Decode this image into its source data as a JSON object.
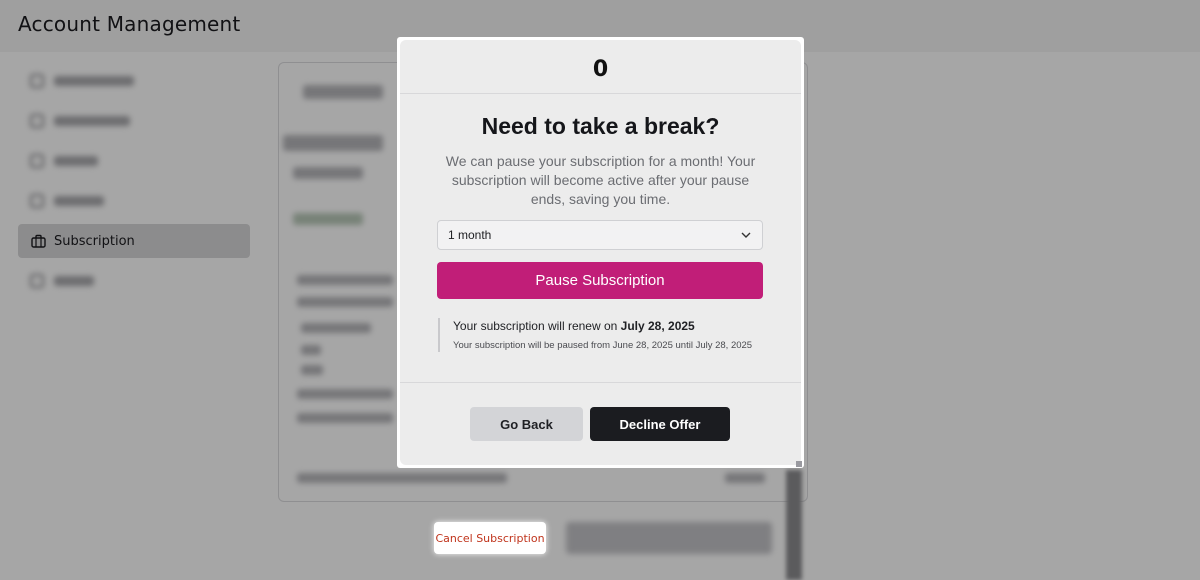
{
  "page": {
    "title": "Account Management"
  },
  "sidebar": {
    "items": [
      {
        "label": "",
        "icon": "placeholder-icon",
        "active": false
      },
      {
        "label": "",
        "icon": "placeholder-icon",
        "active": false
      },
      {
        "label": "",
        "icon": "placeholder-icon",
        "active": false
      },
      {
        "label": "",
        "icon": "placeholder-icon",
        "active": false
      },
      {
        "label": "Subscription",
        "icon": "briefcase-icon",
        "active": true
      },
      {
        "label": "",
        "icon": "placeholder-icon",
        "active": false
      }
    ]
  },
  "footer": {
    "cancel_label": "Cancel Subscription"
  },
  "modal": {
    "logo": "0",
    "heading": "Need to take a break?",
    "description": "We can pause your subscription for a month! Your subscription will become active after your pause ends, saving you time.",
    "duration_select": {
      "value": "1 month"
    },
    "pause_button": "Pause Subscription",
    "renew_prefix": "Your subscription will renew on ",
    "renew_date": "July 28, 2025",
    "pause_info": "Your subscription will be paused from June 28, 2025 until July 28, 2025",
    "go_back_label": "Go Back",
    "decline_label": "Decline Offer"
  },
  "colors": {
    "accent": "#c11e78",
    "dark_button": "#1b1c20",
    "cancel_text": "#c0341c"
  }
}
